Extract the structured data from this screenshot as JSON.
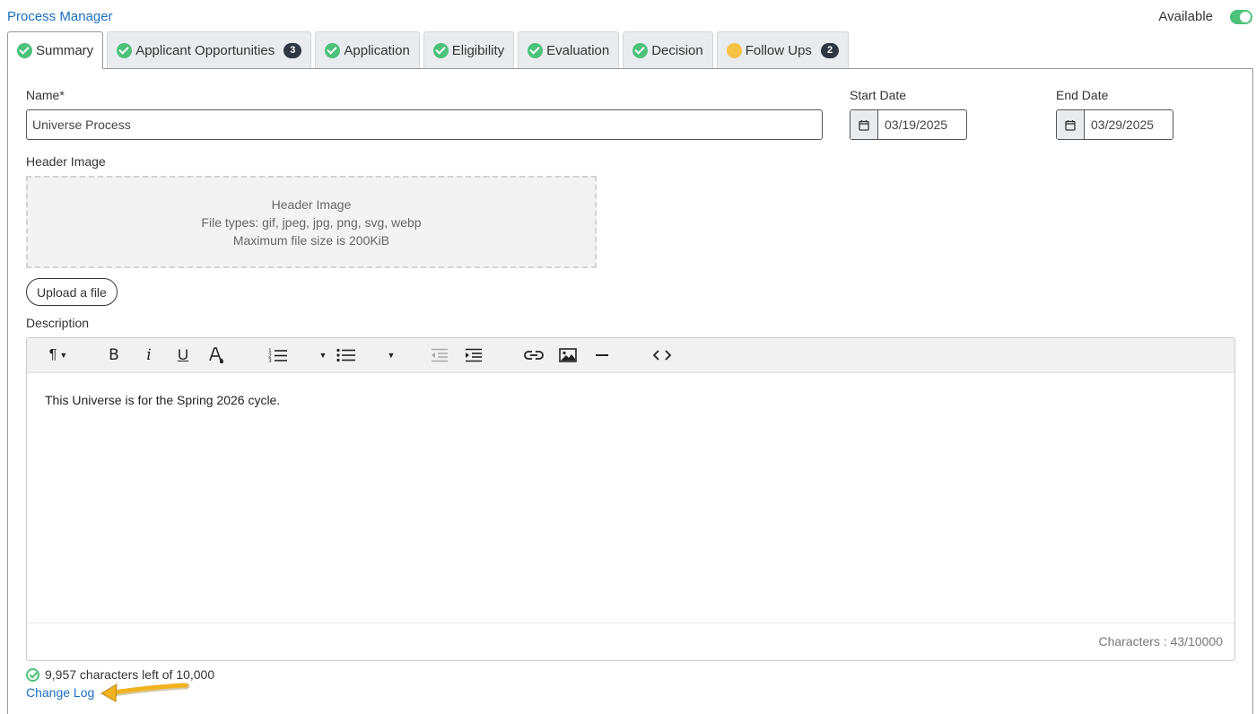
{
  "header": {
    "title": "Process Manager",
    "available_label": "Available",
    "available_on": true
  },
  "tabs": [
    {
      "label": "Summary",
      "status": "complete",
      "active": true
    },
    {
      "label": "Applicant Opportunities",
      "status": "complete",
      "badge": "3"
    },
    {
      "label": "Application",
      "status": "complete"
    },
    {
      "label": "Eligibility",
      "status": "complete"
    },
    {
      "label": "Evaluation",
      "status": "complete"
    },
    {
      "label": "Decision",
      "status": "complete"
    },
    {
      "label": "Follow Ups",
      "status": "pending",
      "badge": "2"
    }
  ],
  "form": {
    "name_label": "Name*",
    "name_value": "Universe Process",
    "start_label": "Start Date",
    "start_value": "03/19/2025",
    "end_label": "End Date",
    "end_value": "03/29/2025",
    "header_image_label": "Header Image",
    "dropzone": {
      "title": "Header Image",
      "types": "File types: gif, jpeg, jpg, png, svg, webp",
      "max": "Maximum file size is 200KiB"
    },
    "upload_label": "Upload a file",
    "description_label": "Description"
  },
  "editor": {
    "toolbar_icons": [
      "paragraph-icon",
      "bold-icon",
      "italic-icon",
      "underline-icon",
      "text-color-icon",
      "ordered-list-icon",
      "bullet-list-icon",
      "outdent-icon",
      "indent-icon",
      "link-icon",
      "image-icon",
      "horizontal-rule-icon",
      "code-view-icon"
    ],
    "content": "This Universe is for the Spring 2026 cycle.",
    "counter": "Characters : 43/10000"
  },
  "footer": {
    "chars_left": "9,957 characters left of 10,000",
    "change_log": "Change Log"
  },
  "colors": {
    "link": "#1a6fc2",
    "success": "#4cc17a",
    "pending": "#f6c244",
    "badge": "#2f3742",
    "arrow": "#f1b21f"
  }
}
